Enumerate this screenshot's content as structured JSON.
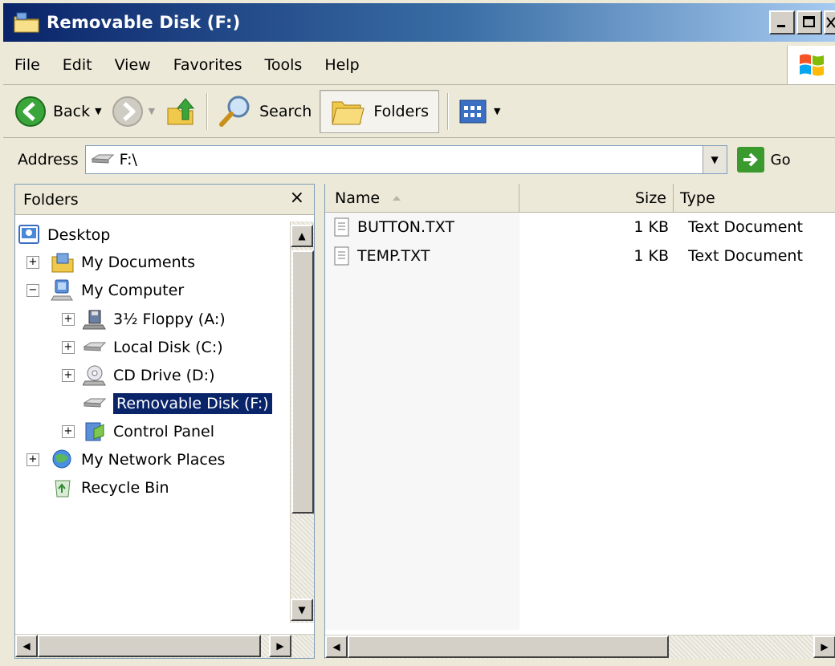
{
  "window": {
    "title": "Removable Disk (F:)",
    "accent_color": "#0a246a",
    "caption_buttons": [
      "minimize",
      "maximize",
      "close"
    ]
  },
  "menu": {
    "items": [
      {
        "label": "File"
      },
      {
        "label": "Edit"
      },
      {
        "label": "View"
      },
      {
        "label": "Favorites"
      },
      {
        "label": "Tools"
      },
      {
        "label": "Help"
      }
    ]
  },
  "toolbar": {
    "back_label": "Back",
    "search_label": "Search",
    "folders_label": "Folders",
    "icons": [
      "back-arrow-icon",
      "forward-arrow-icon",
      "up-folder-icon",
      "search-icon",
      "folders-icon",
      "views-icon"
    ]
  },
  "address": {
    "label": "Address",
    "value": "F:\\",
    "go_label": "Go"
  },
  "folders_pane": {
    "title": "Folders",
    "close_glyph": "×",
    "tree": [
      {
        "label": "Desktop",
        "icon": "desktop-icon",
        "expander": ""
      },
      {
        "label": "My Documents",
        "icon": "my-documents-icon",
        "expander": "+"
      },
      {
        "label": "My Computer",
        "icon": "my-computer-icon",
        "expander": "−"
      },
      {
        "label": "3½ Floppy (A:)",
        "icon": "floppy-icon",
        "expander": "+"
      },
      {
        "label": "Local Disk (C:)",
        "icon": "local-disk-icon",
        "expander": "+"
      },
      {
        "label": "CD Drive (D:)",
        "icon": "cd-drive-icon",
        "expander": "+"
      },
      {
        "label": "Removable Disk (F:)",
        "icon": "removable-disk-icon",
        "expander": "",
        "selected": true
      },
      {
        "label": "Control Panel",
        "icon": "control-panel-icon",
        "expander": "+"
      },
      {
        "label": "My Network Places",
        "icon": "network-places-icon",
        "expander": "+"
      },
      {
        "label": "Recycle Bin",
        "icon": "recycle-bin-icon",
        "expander": ""
      }
    ]
  },
  "file_list": {
    "columns": [
      {
        "label": "Name",
        "sort": "ascending"
      },
      {
        "label": "Size"
      },
      {
        "label": "Type"
      }
    ],
    "rows": [
      {
        "name": "BUTTON.TXT",
        "size": "1 KB",
        "type": "Text Document"
      },
      {
        "name": "TEMP.TXT",
        "size": "1 KB",
        "type": "Text Document"
      }
    ]
  }
}
